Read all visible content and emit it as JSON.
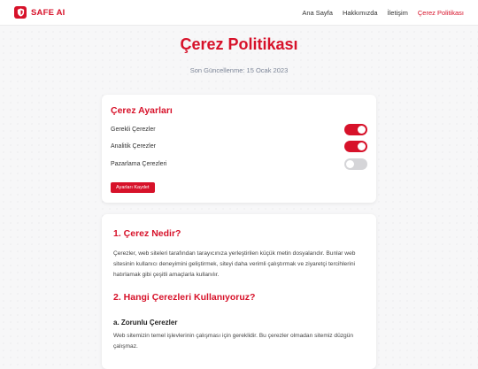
{
  "brand": {
    "name": "SAFE AI",
    "logo_icon": "shield-icon",
    "accent_color": "#d7122a"
  },
  "nav": {
    "items": [
      {
        "label": "Ana Sayfa"
      },
      {
        "label": "Hakkımızda"
      },
      {
        "label": "İletişim"
      },
      {
        "label": "Çerez Politikası",
        "active": true
      }
    ]
  },
  "hero": {
    "title": "Çerez Politikası",
    "updated": "Son Güncellenme: 15 Ocak 2023"
  },
  "settings": {
    "title": "Çerez Ayarları",
    "toggles": [
      {
        "label": "Gerekli Çerezler",
        "enabled": true
      },
      {
        "label": "Analitik Çerezler",
        "enabled": true
      },
      {
        "label": "Pazarlama Çerezleri",
        "enabled": false
      }
    ],
    "save_label": "Ayarları Kaydet"
  },
  "content": {
    "section1_title": "1. Çerez Nedir?",
    "section1_text": "Çerezler, web siteleri tarafından tarayıcınıza yerleştirilen küçük metin dosyalarıdır. Bunlar web sitesinin kullanıcı deneyimini geliştirmek, siteyi daha verimli çalıştırmak ve ziyaretçi tercihlerini hatırlamak gibi çeşitli amaçlarla kullanılır.",
    "section2_title": "2. Hangi Çerezleri Kullanıyoruz?",
    "section2a_title": "a. Zorunlu Çerezler",
    "section2a_text": "Web sitemizin temel işlevlerinin çalışması için gereklidir. Bu çerezler olmadan sitemiz düzgün çalışmaz."
  }
}
